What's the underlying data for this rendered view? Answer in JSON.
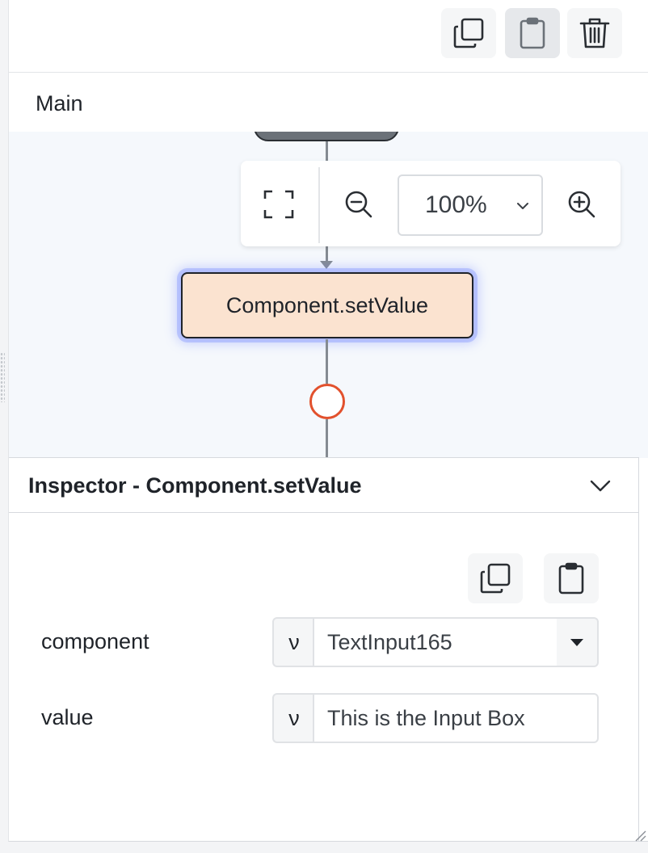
{
  "toolbar": {
    "icons": [
      "copy-icon",
      "clipboard-icon",
      "trash-icon"
    ]
  },
  "tabs": {
    "main_label": "Main"
  },
  "canvas": {
    "zoom_value": "100%",
    "zoom_options": [
      "100%"
    ],
    "node_label": "Component.setValue",
    "colors": {
      "node_fill": "#fbe3d0",
      "node_glow": "#6e82ff",
      "port_stroke": "#e2512d",
      "canvas_bg": "#f5f8fc"
    }
  },
  "inspector": {
    "title": "Inspector - Component.setValue",
    "fields": [
      {
        "label": "component",
        "prefix": "ν",
        "value": "TextInput165"
      },
      {
        "label": "value",
        "prefix": "ν",
        "value": "This is the Input Box"
      }
    ]
  }
}
